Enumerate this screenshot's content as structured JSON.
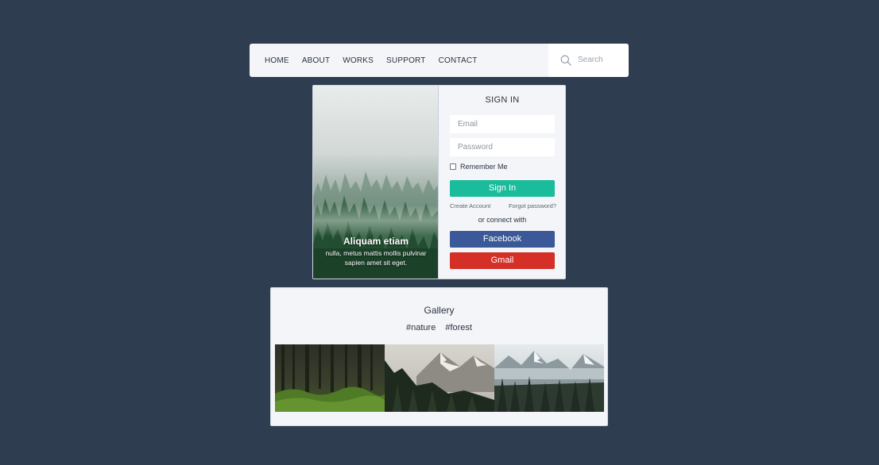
{
  "nav": {
    "links": [
      "HOME",
      "ABOUT",
      "WORKS",
      "SUPPORT",
      "CONTACT"
    ],
    "search_placeholder": "Search",
    "search_icon": "search-icon"
  },
  "login": {
    "hero": {
      "title": "Aliquam etiam",
      "text": "nulla, metus mattis mollis pulvinar sapien amet sit eget."
    },
    "title": "SIGN IN",
    "email_placeholder": "Email",
    "password_placeholder": "Password",
    "remember_label": "Remember Me",
    "signin_label": "Sign In",
    "create_account": "Create Account",
    "forgot_password": "Forgot password?",
    "connect_text": "or connect with",
    "facebook_label": "Facebook",
    "gmail_label": "Gmail"
  },
  "gallery": {
    "title": "Gallery",
    "tags": [
      "#nature",
      "#forest"
    ]
  },
  "colors": {
    "background": "#2e3d50",
    "panel": "#f3f5f8",
    "signin": "#1bbc9b",
    "facebook": "#3b5998",
    "gmail": "#d43027"
  }
}
